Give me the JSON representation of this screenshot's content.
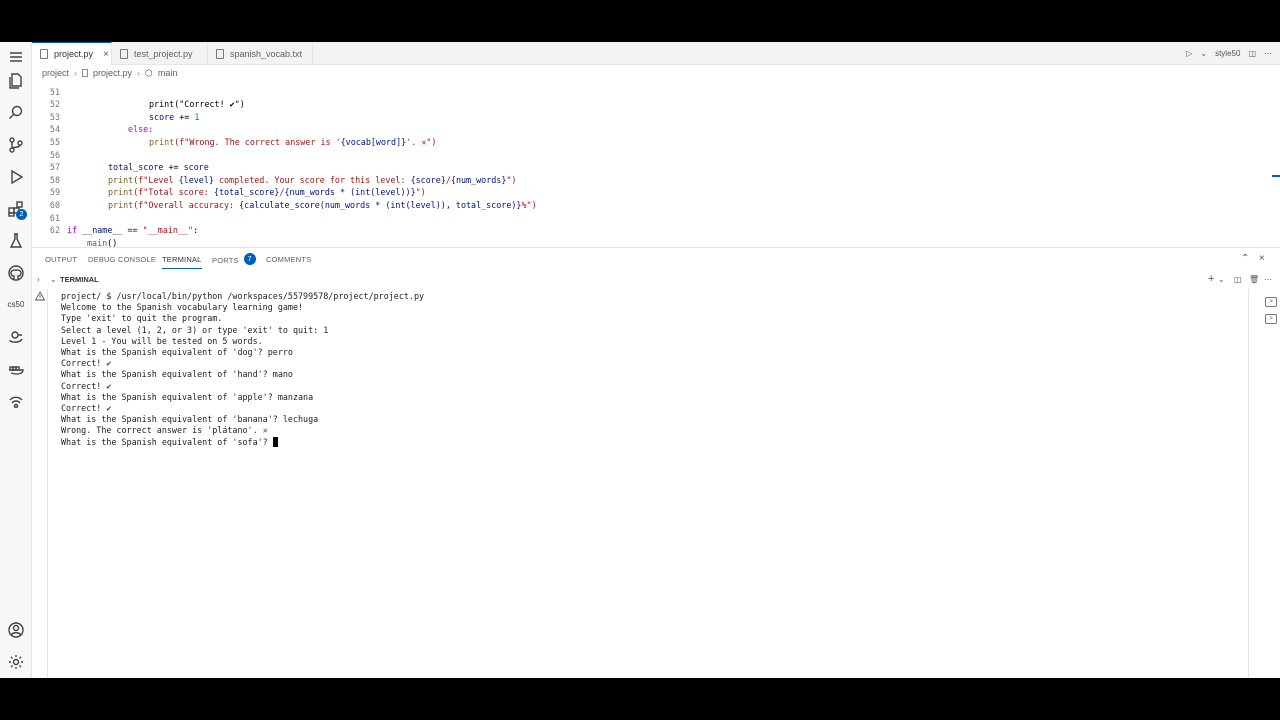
{
  "tabs": [
    {
      "label": "project.py",
      "active": true
    },
    {
      "label": "test_project.py",
      "active": false
    },
    {
      "label": "spanish_vocab.txt",
      "active": false
    }
  ],
  "tab_actions": {
    "run_label": "style50"
  },
  "breadcrumb": {
    "folder": "project",
    "file": "project.py",
    "symbol": "main"
  },
  "editor": {
    "line_numbers": [
      "51",
      "52",
      "53",
      "54",
      "55",
      "56",
      "57",
      "58",
      "59",
      "60",
      "61",
      "62"
    ],
    "line51": "print(\"Correct! ✔\")",
    "line52_a": "score",
    "line52_b": " += ",
    "line52_c": "1",
    "line53": "else:",
    "line54_a": "print",
    "line54_b": "(f\"Wrong. The correct answer is '",
    "line54_c": "{vocab[word]}",
    "line54_d": "'. ",
    "line54_e": "✕",
    "line54_f": "\")",
    "line56_a": "total_score",
    "line56_b": " += ",
    "line56_c": "score",
    "line57_a": "print",
    "line57_b": "(f\"Level ",
    "line57_c": "{level}",
    "line57_d": " completed. Your score for this level: ",
    "line57_e": "{score}",
    "line57_f": "/",
    "line57_g": "{num_words}",
    "line57_h": "\")",
    "line58_a": "print",
    "line58_b": "(f\"Total score: ",
    "line58_c": "{total_score}",
    "line58_d": "/",
    "line58_e": "{num_words * (int(level))}",
    "line58_f": "\")",
    "line59_a": "print",
    "line59_b": "(f\"Overall accuracy: ",
    "line59_c": "{calculate_score(num_words * (int(level)), total_score)}",
    "line59_d": "%\")",
    "line61_a": "if",
    "line61_b": " __name__ == ",
    "line61_c": "\"__main__\"",
    "line61_d": ":",
    "line62_a": "main",
    "line62_b": "()"
  },
  "panel": {
    "tabs": [
      "OUTPUT",
      "DEBUG CONSOLE",
      "TERMINAL",
      "PORTS",
      "COMMENTS"
    ],
    "ports_count": "7",
    "terminal_title": "TERMINAL"
  },
  "terminal": {
    "lines": [
      "project/ $ /usr/local/bin/python /workspaces/55799578/project/project.py",
      "Welcome to the Spanish vocabulary learning game!",
      "Type 'exit' to quit the program.",
      "Select a level (1, 2, or 3) or type 'exit' to quit: 1",
      "Level 1 - You will be tested on 5 words.",
      "What is the Spanish equivalent of 'dog'? perro",
      "Correct! ",
      "What is the Spanish equivalent of 'hand'? mano",
      "Correct! ",
      "What is the Spanish equivalent of 'apple'? manzana",
      "Correct! ",
      "What is the Spanish equivalent of 'banana'? lechuga",
      "Wrong. The correct answer is 'plátano'. ",
      "What is the Spanish equivalent of 'sofa'? "
    ],
    "check_glyph": "✔",
    "cross_glyph": "✕"
  },
  "activity_bar": {
    "cs50_label": "cs50",
    "extensions_badge": "2"
  },
  "colors": {
    "accent": "#005fb8",
    "keyword": "#af00db",
    "function": "#795e26",
    "string": "#a31515"
  }
}
